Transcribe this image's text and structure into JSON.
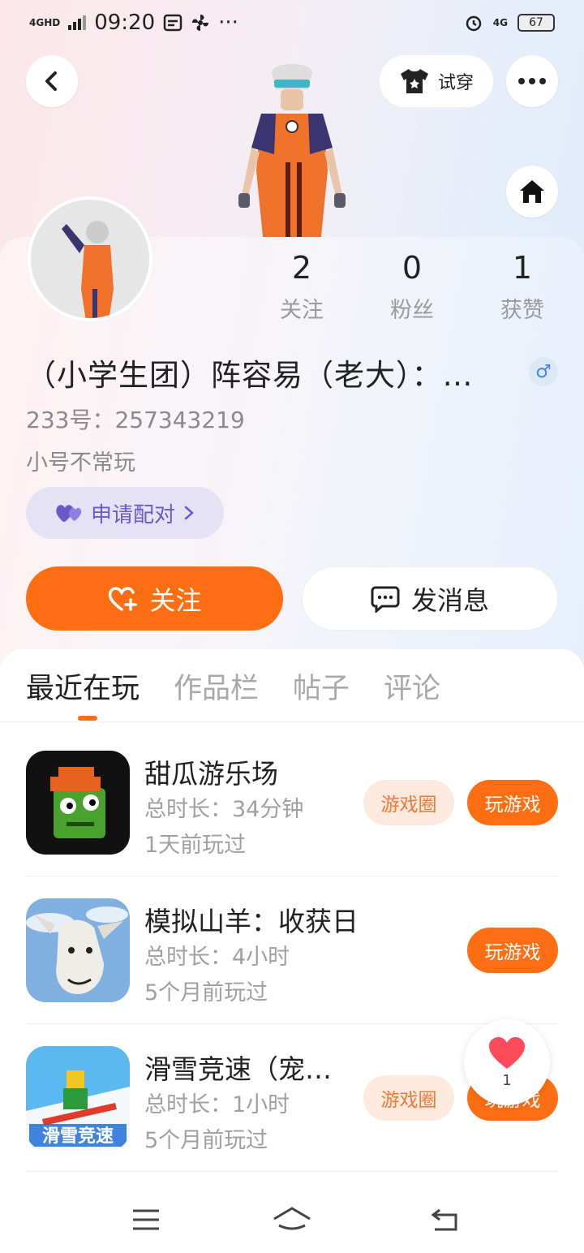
{
  "status_bar": {
    "network": "4GHD",
    "time": "09:20",
    "right_network": "4G",
    "battery": "67"
  },
  "header": {
    "tryon_label": "试穿"
  },
  "profile": {
    "stats": [
      {
        "value": "2",
        "label": "关注"
      },
      {
        "value": "0",
        "label": "粉丝"
      },
      {
        "value": "1",
        "label": "获赞"
      }
    ],
    "nickname": "（小学生团）阵容易（老大）：…",
    "gender_symbol": "♂",
    "uid": "233号：257343219",
    "bio": "小号不常玩",
    "match_label": "申请配对",
    "follow_label": "关注",
    "message_label": "发消息"
  },
  "tabs": [
    "最近在玩",
    "作品栏",
    "帖子",
    "评论"
  ],
  "games": [
    {
      "name": "甜瓜游乐场",
      "duration": "总时长：34分钟",
      "last_played": "1天前玩过",
      "circle_label": "游戏圈",
      "play_label": "玩游戏"
    },
    {
      "name": "模拟山羊：收获日",
      "duration": "总时长：4小时",
      "last_played": "5个月前玩过",
      "play_label": "玩游戏"
    },
    {
      "name": "滑雪竞速（宠…",
      "duration": "总时长：1小时",
      "last_played": "5个月前玩过",
      "circle_label": "游戏圈",
      "play_label": "玩游戏",
      "icon_text": "滑雪竞速"
    }
  ],
  "like_float": {
    "count": "1"
  },
  "colors": {
    "accent": "#ff6e12",
    "match": "#6a59c9",
    "gender": "#3f86e0"
  }
}
